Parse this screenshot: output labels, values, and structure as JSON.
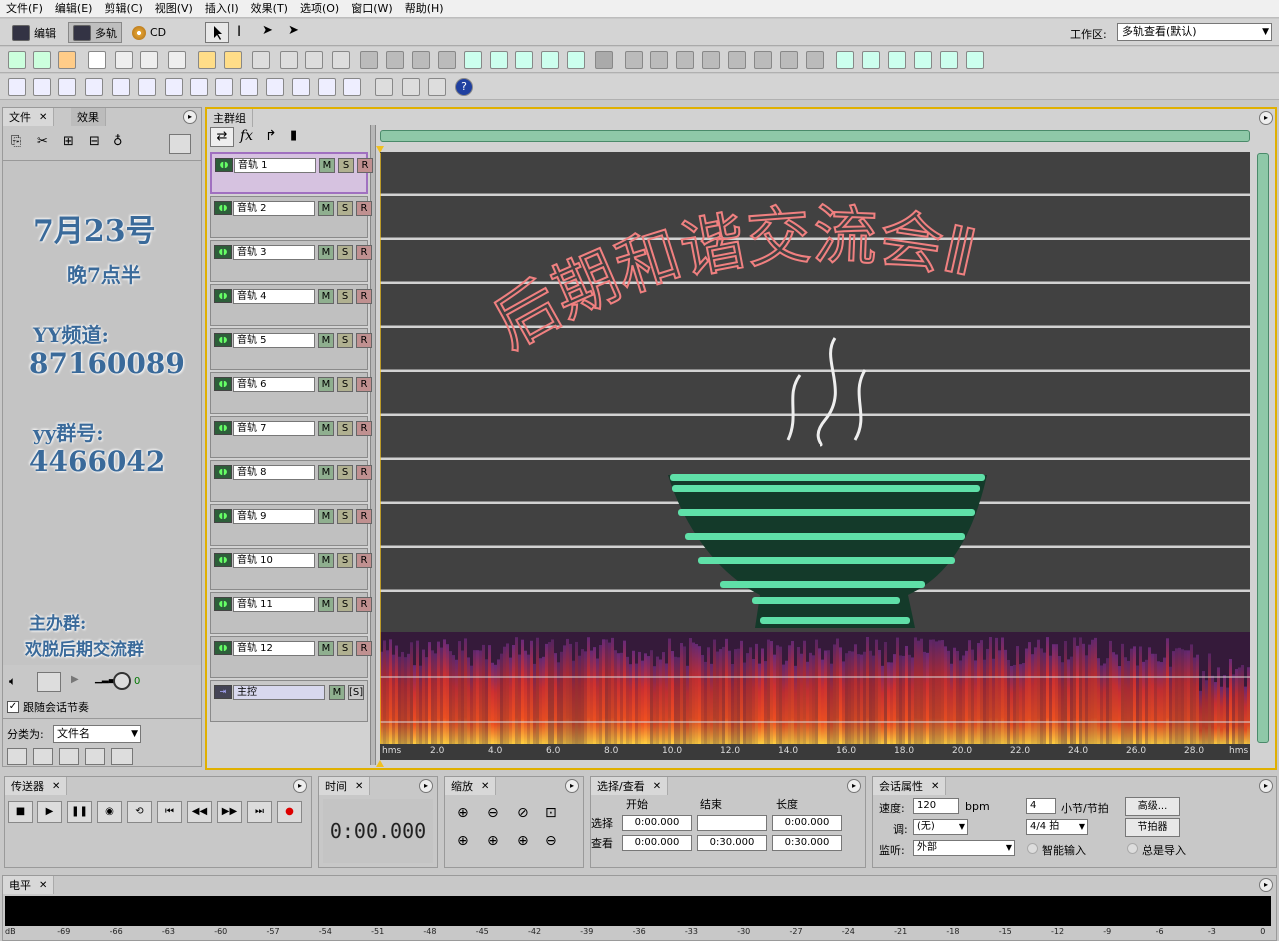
{
  "menu": [
    "文件(F)",
    "编辑(E)",
    "剪辑(C)",
    "视图(V)",
    "插入(I)",
    "效果(T)",
    "选项(O)",
    "窗口(W)",
    "帮助(H)"
  ],
  "modes": {
    "edit": "编辑",
    "multitrack": "多轨",
    "cd": "CD"
  },
  "workspace": {
    "label": "工作区:",
    "value": "多轨查看(默认)"
  },
  "files_panel": {
    "tab_files": "文件",
    "tab_effects": "效果",
    "follow_label": "跟随会话节奏",
    "sort_label": "分类为:",
    "sort_value": "文件名",
    "volume_value": "0"
  },
  "side_ad": {
    "line1": "7月23号",
    "line2": "晚7点半",
    "line3": "YY频道:",
    "line4": "87160089",
    "line5": "yy群号:",
    "line6": "4466042",
    "line7": "主办群:",
    "line8": "欢脱后期交流群"
  },
  "mixer": {
    "tab": "主群组",
    "tracks": [
      "音轨 1",
      "音轨 2",
      "音轨 3",
      "音轨 4",
      "音轨 5",
      "音轨 6",
      "音轨 7",
      "音轨 8",
      "音轨 9",
      "音轨 10",
      "音轨 11",
      "音轨 12"
    ],
    "master": "主控",
    "m": "M",
    "s": "S",
    "r": "R",
    "master_s": "[S]"
  },
  "overlay_title": "后期和谐交流会Ⅱ",
  "ruler": {
    "unit": "hms",
    "ticks": [
      "2.0",
      "4.0",
      "6.0",
      "8.0",
      "10.0",
      "12.0",
      "14.0",
      "16.0",
      "18.0",
      "20.0",
      "22.0",
      "24.0",
      "26.0",
      "28.0"
    ]
  },
  "transport": {
    "tab": "传送器"
  },
  "time": {
    "tab": "时间",
    "value": "0:00.000"
  },
  "zoom": {
    "tab": "缩放"
  },
  "selection": {
    "tab": "选择/查看",
    "col_start": "开始",
    "col_end": "结束",
    "col_length": "长度",
    "row_select": "选择",
    "row_view": "查看",
    "sel_start": "0:00.000",
    "sel_end": "",
    "sel_length": "0:00.000",
    "view_start": "0:00.000",
    "view_end": "0:30.000",
    "view_length": "0:30.000"
  },
  "session": {
    "tab": "会话属性",
    "tempo_label": "速度:",
    "tempo_value": "120",
    "tempo_unit": "bpm",
    "beats_value": "4",
    "beats_label": "小节/节拍",
    "advanced_button": "高级...",
    "key_label": "调:",
    "key_value": "(无)",
    "time_sig_value": "4/4 拍",
    "metronome_button": "节拍器",
    "monitor_label": "监听:",
    "monitor_value": "外部",
    "smart_input": "智能输入",
    "always_input": "总是导入"
  },
  "levels": {
    "tab": "电平",
    "ticks": [
      "dB",
      "-69",
      "-66",
      "-63",
      "-60",
      "-57",
      "-54",
      "-51",
      "-48",
      "-45",
      "-42",
      "-39",
      "-36",
      "-33",
      "-30",
      "-27",
      "-24",
      "-21",
      "-18",
      "-15",
      "-12",
      "-9",
      "-6",
      "-3",
      "0"
    ]
  },
  "colors": {
    "title_pink": "#f08080",
    "bowl_green": "#5fe0a8",
    "lane_bg": "#414141",
    "accent_yellow": "#f0c020"
  }
}
